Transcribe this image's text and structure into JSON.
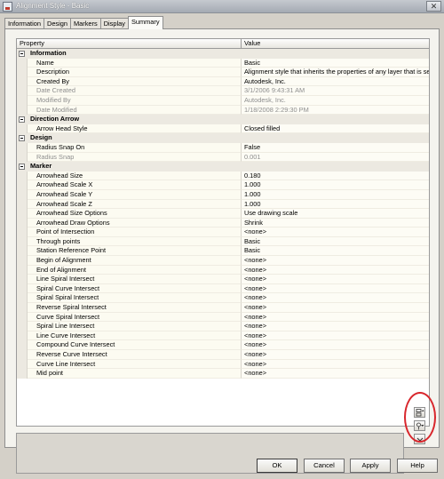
{
  "window": {
    "title": "Alignment Style - Basic",
    "close_label": "✕"
  },
  "tabs": [
    {
      "label": "Information",
      "active": false
    },
    {
      "label": "Design",
      "active": false
    },
    {
      "label": "Markers",
      "active": false
    },
    {
      "label": "Display",
      "active": false
    },
    {
      "label": "Summary",
      "active": true
    }
  ],
  "grid": {
    "columns": {
      "property": "Property",
      "value": "Value"
    },
    "rows": [
      {
        "type": "category",
        "label": "Information"
      },
      {
        "type": "prop",
        "name": "Name",
        "value": "Basic",
        "dim": false
      },
      {
        "type": "prop",
        "name": "Description",
        "value": "Alignment style that inherits the properties of any layer that is selected",
        "dim": false
      },
      {
        "type": "prop",
        "name": "Created By",
        "value": "Autodesk, Inc.",
        "dim": false
      },
      {
        "type": "prop",
        "name": "Date Created",
        "value": "3/1/2006 9:43:31 AM",
        "dim": true
      },
      {
        "type": "prop",
        "name": "Modified By",
        "value": "Autodesk, Inc.",
        "dim": true
      },
      {
        "type": "prop",
        "name": "Date Modified",
        "value": "1/18/2008 2:29:30 PM",
        "dim": true
      },
      {
        "type": "category",
        "label": "Direction Arrow"
      },
      {
        "type": "prop",
        "name": "Arrow Head Style",
        "value": "Closed filled",
        "dim": false
      },
      {
        "type": "category",
        "label": "Design"
      },
      {
        "type": "prop",
        "name": "Radius Snap On",
        "value": "False",
        "dim": false
      },
      {
        "type": "prop",
        "name": "Radius Snap",
        "value": "0.001",
        "dim": true
      },
      {
        "type": "category",
        "label": "Marker"
      },
      {
        "type": "prop",
        "name": "Arrowhead Size",
        "value": "0.180",
        "dim": false
      },
      {
        "type": "prop",
        "name": "Arrowhead Scale X",
        "value": "1.000",
        "dim": false
      },
      {
        "type": "prop",
        "name": "Arrowhead Scale Y",
        "value": "1.000",
        "dim": false
      },
      {
        "type": "prop",
        "name": "Arrowhead Scale Z",
        "value": "1.000",
        "dim": false
      },
      {
        "type": "prop",
        "name": "Arrowhead Size Options",
        "value": "Use drawing scale",
        "dim": false
      },
      {
        "type": "prop",
        "name": "Arrowhead Draw Options",
        "value": "Shrink",
        "dim": false
      },
      {
        "type": "prop",
        "name": "Point of Intersection",
        "value": "<none>",
        "dim": false
      },
      {
        "type": "prop",
        "name": "Through points",
        "value": "Basic",
        "dim": false
      },
      {
        "type": "prop",
        "name": "Station Reference Point",
        "value": "Basic",
        "dim": false
      },
      {
        "type": "prop",
        "name": "Begin of Alignment",
        "value": "<none>",
        "dim": false
      },
      {
        "type": "prop",
        "name": "End of Alignment",
        "value": "<none>",
        "dim": false
      },
      {
        "type": "prop",
        "name": "Line Spiral Intersect",
        "value": "<none>",
        "dim": false
      },
      {
        "type": "prop",
        "name": "Spiral Curve Intersect",
        "value": "<none>",
        "dim": false
      },
      {
        "type": "prop",
        "name": "Spiral Spiral Intersect",
        "value": "<none>",
        "dim": false
      },
      {
        "type": "prop",
        "name": "Reverse Spiral Intersect",
        "value": "<none>",
        "dim": false
      },
      {
        "type": "prop",
        "name": "Curve Spiral Intersect",
        "value": "<none>",
        "dim": false
      },
      {
        "type": "prop",
        "name": "Spiral Line Intersect",
        "value": "<none>",
        "dim": false
      },
      {
        "type": "prop",
        "name": "Line Curve Intersect",
        "value": "<none>",
        "dim": false
      },
      {
        "type": "prop",
        "name": "Compound Curve Intersect",
        "value": "<none>",
        "dim": false
      },
      {
        "type": "prop",
        "name": "Reverse Curve Intersect",
        "value": "<none>",
        "dim": false
      },
      {
        "type": "prop",
        "name": "Curve Line Intersect",
        "value": "<none>",
        "dim": false
      },
      {
        "type": "prop",
        "name": "Mid point",
        "value": "<none>",
        "dim": false
      }
    ]
  },
  "side_buttons": [
    {
      "name": "collapse-categories-button",
      "icon": "collapse-icon"
    },
    {
      "name": "filter-properties-button",
      "icon": "filter-icon"
    },
    {
      "name": "scroll-down-button",
      "icon": "chevron-down-icon"
    }
  ],
  "buttons": {
    "ok": "OK",
    "cancel": "Cancel",
    "apply": "Apply",
    "help": "Help"
  },
  "colors": {
    "highlight_ring": "#d8262c",
    "category_bg": "#ece9e1",
    "dim_text": "#8e8e8e"
  }
}
